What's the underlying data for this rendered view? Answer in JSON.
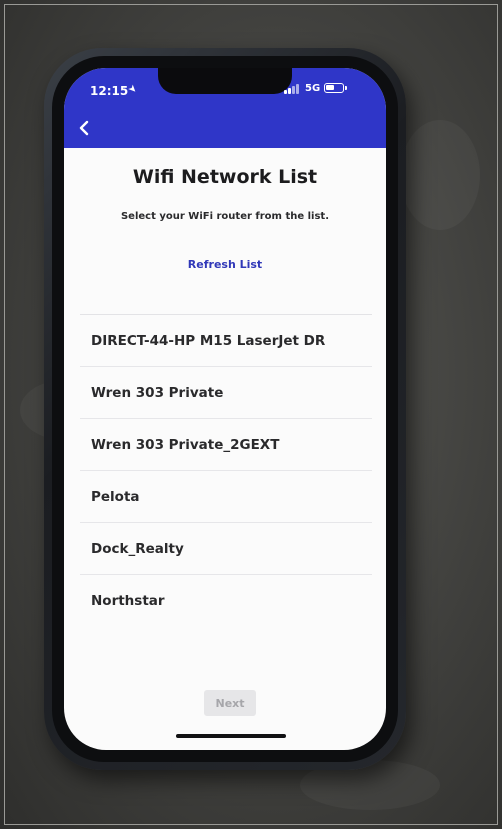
{
  "status_bar": {
    "time": "12:15",
    "network": "5G",
    "battery_level": 0.6,
    "icons": [
      "location-arrow-icon",
      "signal-bars-icon",
      "battery-icon"
    ]
  },
  "header": {
    "back_icon": "chevron-left-icon",
    "color": "#2f36c8"
  },
  "page": {
    "title": "Wifi Network List",
    "subtitle": "Select your WiFi router from the list.",
    "refresh_label": "Refresh List",
    "refresh_color": "#3038b8"
  },
  "networks": [
    {
      "name": "DIRECT-44-HP M15 LaserJet DR"
    },
    {
      "name": "Wren 303 Private"
    },
    {
      "name": "Wren 303 Private_2GEXT"
    },
    {
      "name": "Pelota"
    },
    {
      "name": "Dock_Realty"
    },
    {
      "name": "Northstar"
    }
  ],
  "footer": {
    "next_label": "Next",
    "next_enabled": false
  }
}
